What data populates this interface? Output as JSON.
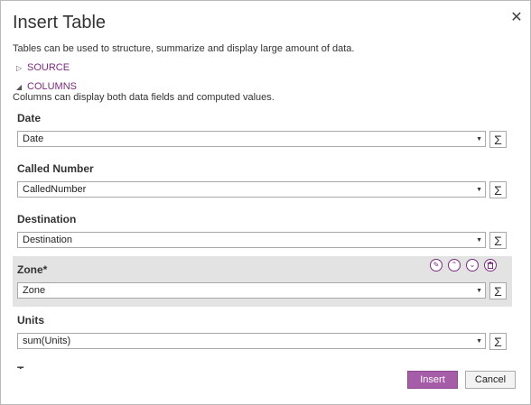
{
  "dialog": {
    "title": "Insert Table",
    "close_glyph": "✕",
    "description": "Tables can be used to structure, summarize and display large amount of data."
  },
  "sections": {
    "source": {
      "label": "SOURCE",
      "expanded": false,
      "caret": "▷"
    },
    "columns": {
      "label": "COLUMNS",
      "expanded": true,
      "caret": "◢",
      "description": "Columns can display both data fields and computed values."
    }
  },
  "columns": [
    {
      "label": "Date",
      "value": "Date"
    },
    {
      "label": "Called Number",
      "value": "CalledNumber"
    },
    {
      "label": "Destination",
      "value": "Destination"
    },
    {
      "label": "Zone*",
      "value": "Zone",
      "selected": true
    },
    {
      "label": "Units",
      "value": "sum(Units)"
    },
    {
      "label": "T",
      "value": ""
    }
  ],
  "icons": {
    "sigma": "Σ",
    "dropdown": "▼",
    "edit": "✎",
    "move_up": "⌃",
    "move_down": "⌄",
    "delete": "🗑"
  },
  "buttons": {
    "insert": "Insert",
    "cancel": "Cancel"
  },
  "colors": {
    "accent": "#a45da6",
    "link": "#7a2b7e",
    "highlight": "#e3e3e3"
  }
}
